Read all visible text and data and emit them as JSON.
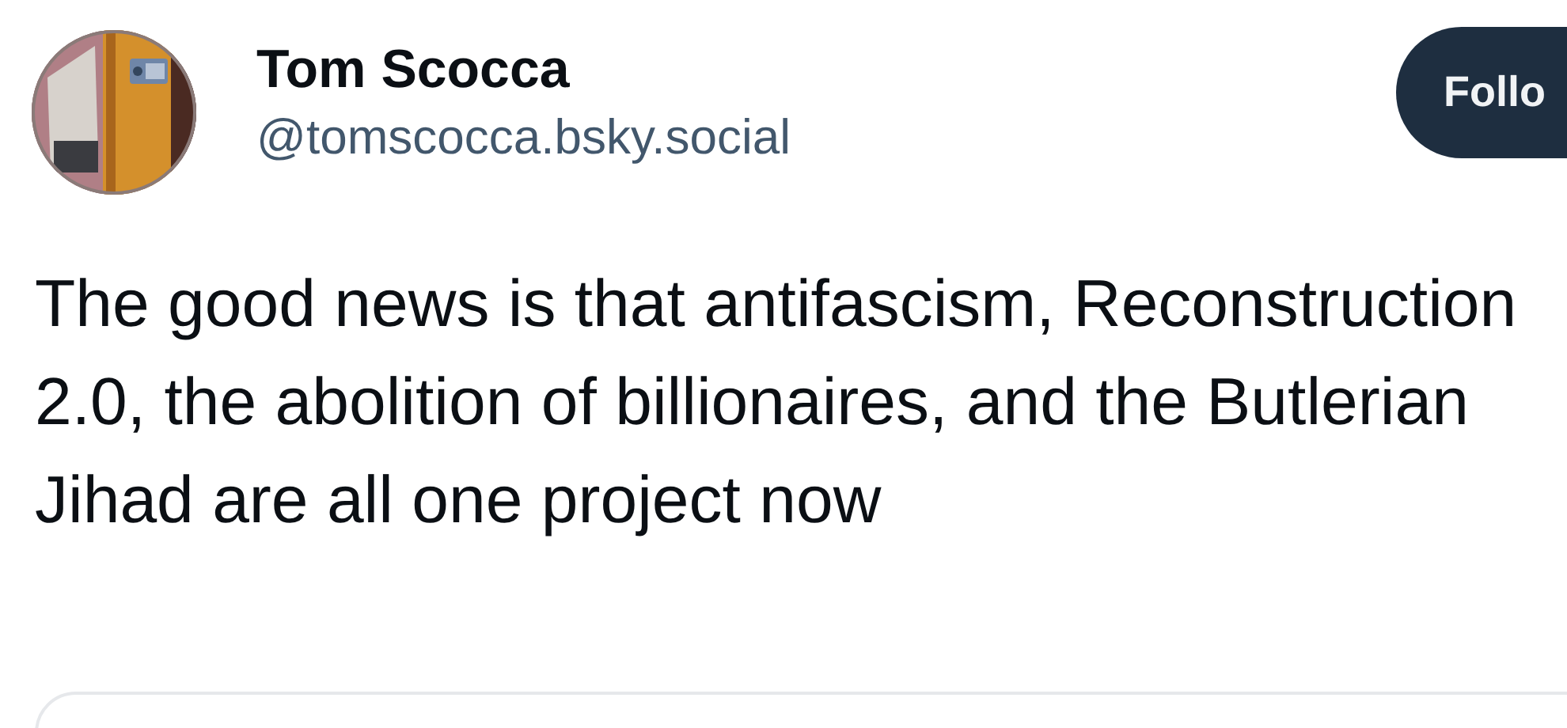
{
  "author": {
    "name": "Tom Scocca",
    "handle": "@tomscocca.bsky.social"
  },
  "follow_button": {
    "label": "Follo"
  },
  "post": {
    "text": "The good news is that antifascism, Reconstruction 2.0, the abolition of billionaires, and the Butlerian Jihad are all one project now"
  }
}
